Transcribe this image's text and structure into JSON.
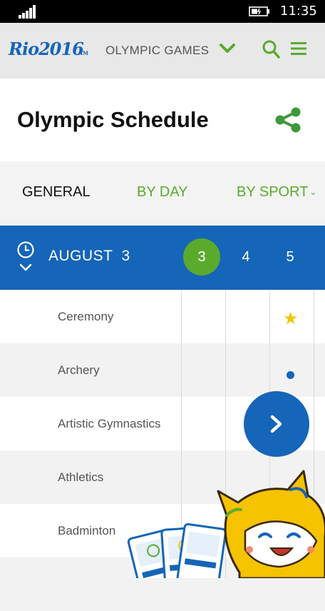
{
  "status": {
    "time": "11:35"
  },
  "header": {
    "logo": "Rio2016",
    "logo_tm": "TM",
    "games_label": "OLYMPIC GAMES"
  },
  "page": {
    "title": "Olympic Schedule"
  },
  "tabs": [
    {
      "label": "GENERAL",
      "active": true
    },
    {
      "label": "BY DAY"
    },
    {
      "label": "BY SPORT"
    }
  ],
  "date": {
    "month": "AUGUST",
    "day": "3",
    "days": [
      {
        "label": "3",
        "active": true
      },
      {
        "label": "4"
      },
      {
        "label": "5"
      }
    ]
  },
  "sports": [
    {
      "name": "Ceremony",
      "marker": "star"
    },
    {
      "name": "Archery",
      "marker": "dot"
    },
    {
      "name": "Artistic Gymnastics"
    },
    {
      "name": "Athletics"
    },
    {
      "name": "Badminton"
    }
  ],
  "colors": {
    "brand_blue": "#1565b8",
    "accent_green": "#5aab2d",
    "star_yellow": "#f5c300"
  },
  "icons": [
    "signal-icon",
    "battery-icon",
    "chevron-down-icon",
    "search-icon",
    "menu-icon",
    "share-icon",
    "clock-icon",
    "chevron-right-icon",
    "star-icon"
  ]
}
